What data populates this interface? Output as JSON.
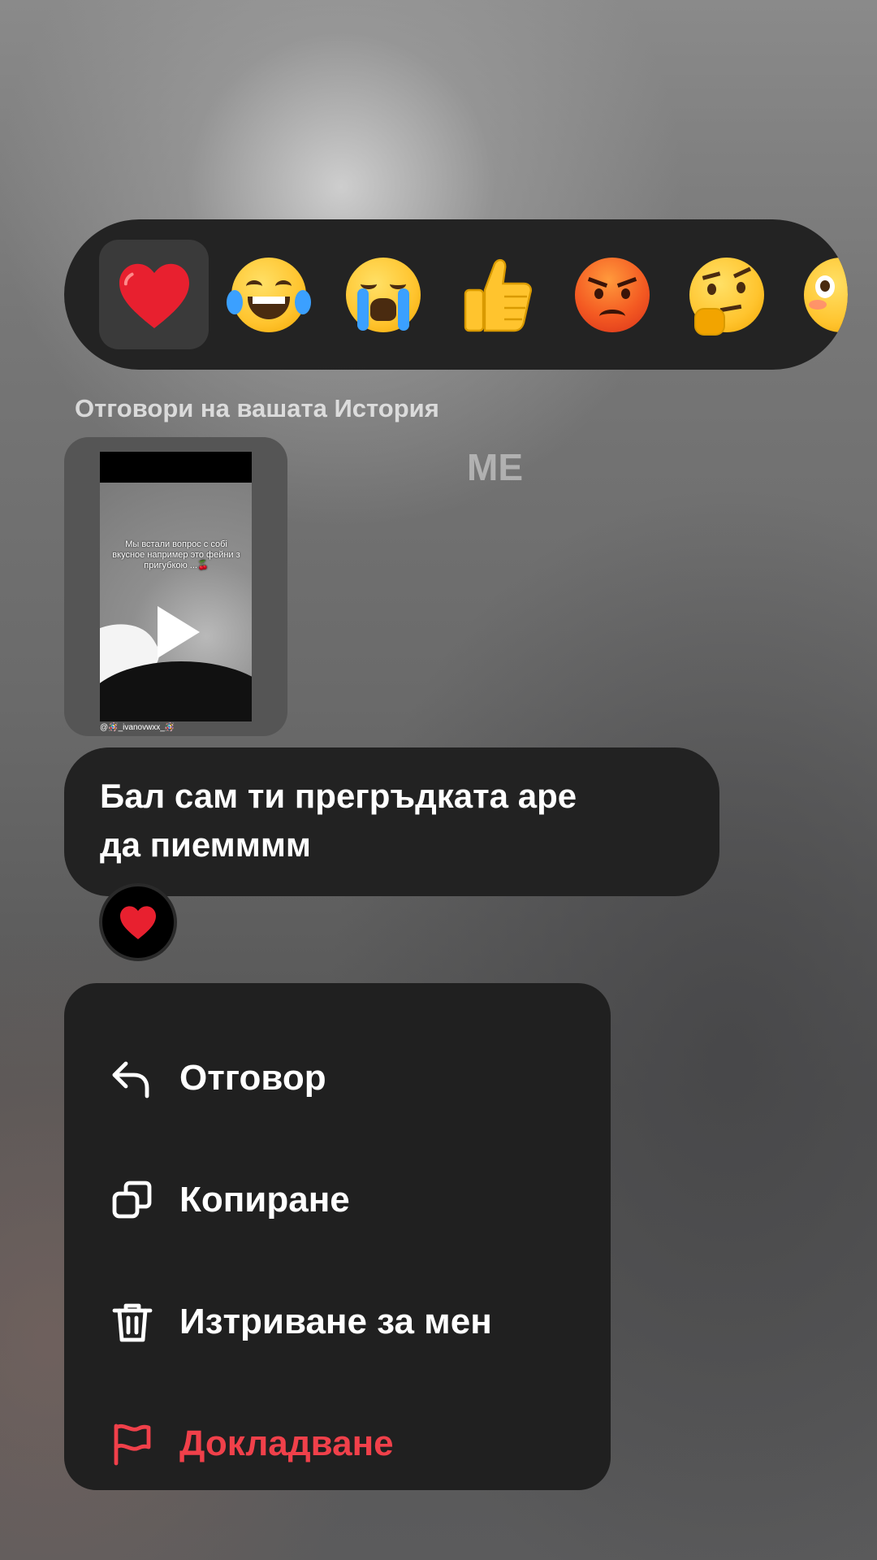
{
  "reactions": [
    {
      "name": "red-heart",
      "selected": true
    },
    {
      "name": "face-with-tears-of-joy"
    },
    {
      "name": "loudly-crying-face"
    },
    {
      "name": "thumbs-up"
    },
    {
      "name": "angry-face"
    },
    {
      "name": "thinking-face"
    },
    {
      "name": "flushed-face",
      "partial": true
    }
  ],
  "story": {
    "label": "Отговори на вашата История",
    "username": "@🪅_ivanovwxx_🪅",
    "overlay_text": "Мы встали вопрос с собі вкусное например это фейни з пригубкою ...🍒",
    "me_label": "ME"
  },
  "message": {
    "text_line1": "Бал сам ти прегръдката аре",
    "text_line2": "да пиемммм",
    "reaction": "❤️"
  },
  "menu": {
    "reply": "Отговор",
    "copy": "Копиране",
    "delete": "Изтриване за мен",
    "report": "Докладване"
  },
  "colors": {
    "bubble": "#222222",
    "menu_bg": "#202020",
    "danger": "#f0404a",
    "heart": "#e8202f"
  }
}
